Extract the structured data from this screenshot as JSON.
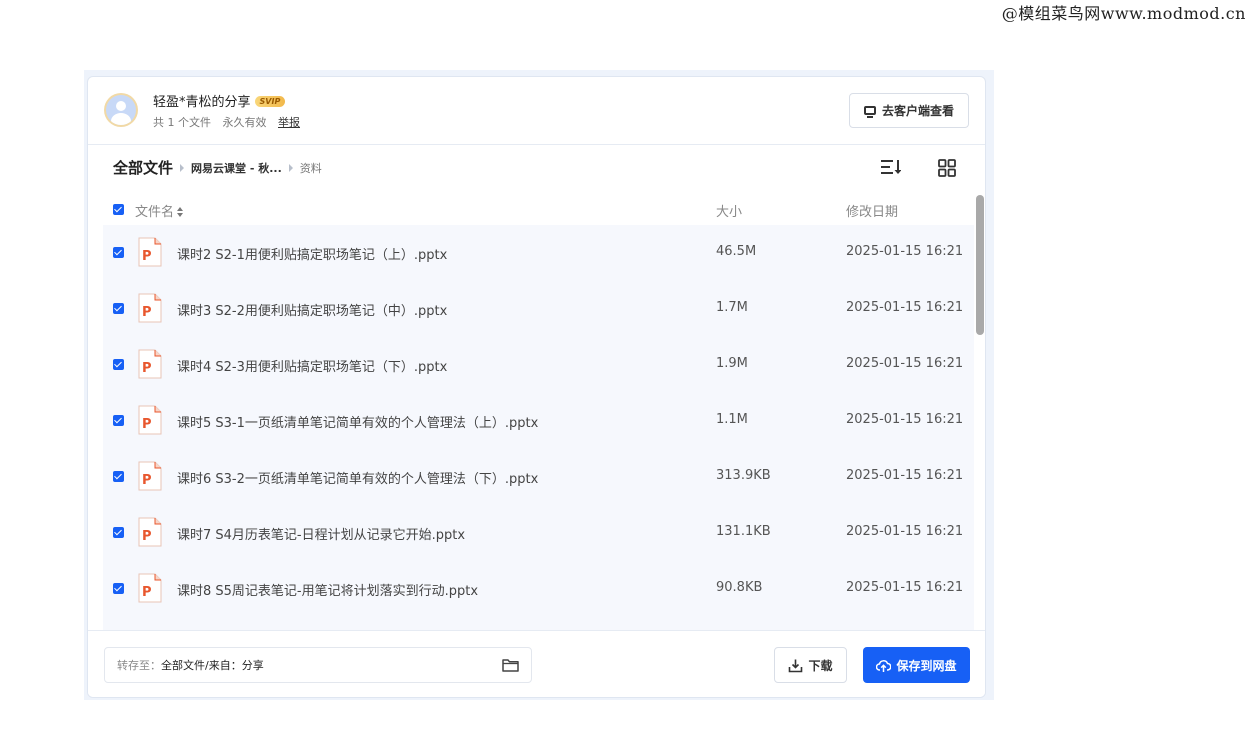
{
  "watermark": "@模组菜鸟网www.modmod.cn",
  "share": {
    "sharer_name": "轻盈*青松的分享",
    "badge": "SVIP",
    "file_count": "共 1 个文件",
    "validity": "永久有效",
    "report_link": "举报",
    "client_button": "去客户端查看"
  },
  "breadcrumb": {
    "root": "全部文件",
    "middle": "网易云课堂 - 秋...",
    "current": "资料"
  },
  "table": {
    "col_name": "文件名",
    "col_size": "大小",
    "col_date": "修改日期",
    "rows": [
      {
        "name": "课时2 S2-1用便利贴搞定职场笔记（上）.pptx",
        "size": "46.5M",
        "date": "2025-01-15 16:21"
      },
      {
        "name": "课时3 S2-2用便利贴搞定职场笔记（中）.pptx",
        "size": "1.7M",
        "date": "2025-01-15 16:21"
      },
      {
        "name": "课时4 S2-3用便利贴搞定职场笔记（下）.pptx",
        "size": "1.9M",
        "date": "2025-01-15 16:21"
      },
      {
        "name": "课时5 S3-1一页纸清单笔记简单有效的个人管理法（上）.pptx",
        "size": "1.1M",
        "date": "2025-01-15 16:21"
      },
      {
        "name": "课时6 S3-2一页纸清单笔记简单有效的个人管理法（下）.pptx",
        "size": "313.9KB",
        "date": "2025-01-15 16:21"
      },
      {
        "name": "课时7 S4月历表笔记-日程计划从记录它开始.pptx",
        "size": "131.1KB",
        "date": "2025-01-15 16:21"
      },
      {
        "name": "课时8 S5周记表笔记-用笔记将计划落实到行动.pptx",
        "size": "90.8KB",
        "date": "2025-01-15 16:21"
      }
    ]
  },
  "footer": {
    "dest_label": "转存至：",
    "dest_value": "全部文件/来自：分享",
    "download_label": "下载",
    "save_label": "保存到网盘"
  },
  "colors": {
    "accent": "#1760f5",
    "ppt_orange": "#e8572e",
    "row_bg": "#f6f8fd"
  }
}
